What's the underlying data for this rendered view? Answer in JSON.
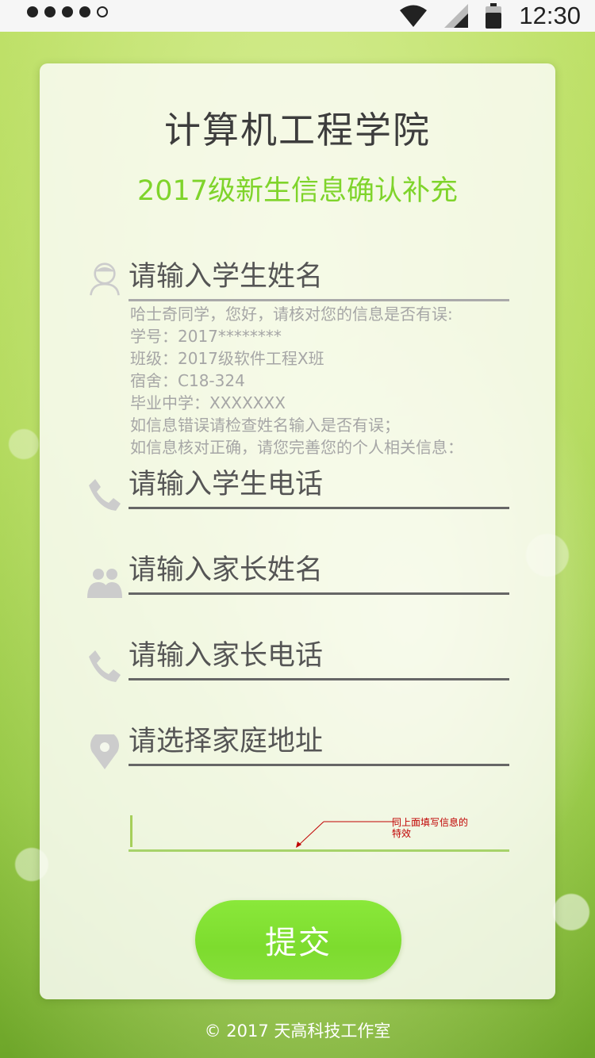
{
  "status_bar": {
    "time": "12:30",
    "icons": [
      "signal-dots",
      "wifi-icon",
      "cell-signal-icon",
      "battery-icon"
    ]
  },
  "header": {
    "title": "计算机工程学院",
    "subtitle": "2017级新生信息确认补充"
  },
  "form": {
    "student_name_placeholder": "请输入学生姓名",
    "info_lines": [
      "哈士奇同学，您好，请核对您的信息是否有误:",
      "学号：2017********",
      "班级：2017级软件工程X班",
      "宿舍：C18-324",
      "毕业中学：XXXXXXX",
      "如信息错误请检查姓名输入是否有误；",
      "如信息核对正确，请您完善您的个人相关信息："
    ],
    "student_phone_placeholder": "请输入学生电话",
    "parent_name_placeholder": "请输入家长姓名",
    "parent_phone_placeholder": "请输入家长电话",
    "address_placeholder": "请选择家庭地址",
    "annotation": "同上面填写信息的特效",
    "submit_label": "提交"
  },
  "footer": {
    "copyright": "© 2017 天高科技工作室"
  },
  "colors": {
    "accent": "#7fd42b",
    "button": "#7ddc2e",
    "annotation": "#c00000"
  }
}
